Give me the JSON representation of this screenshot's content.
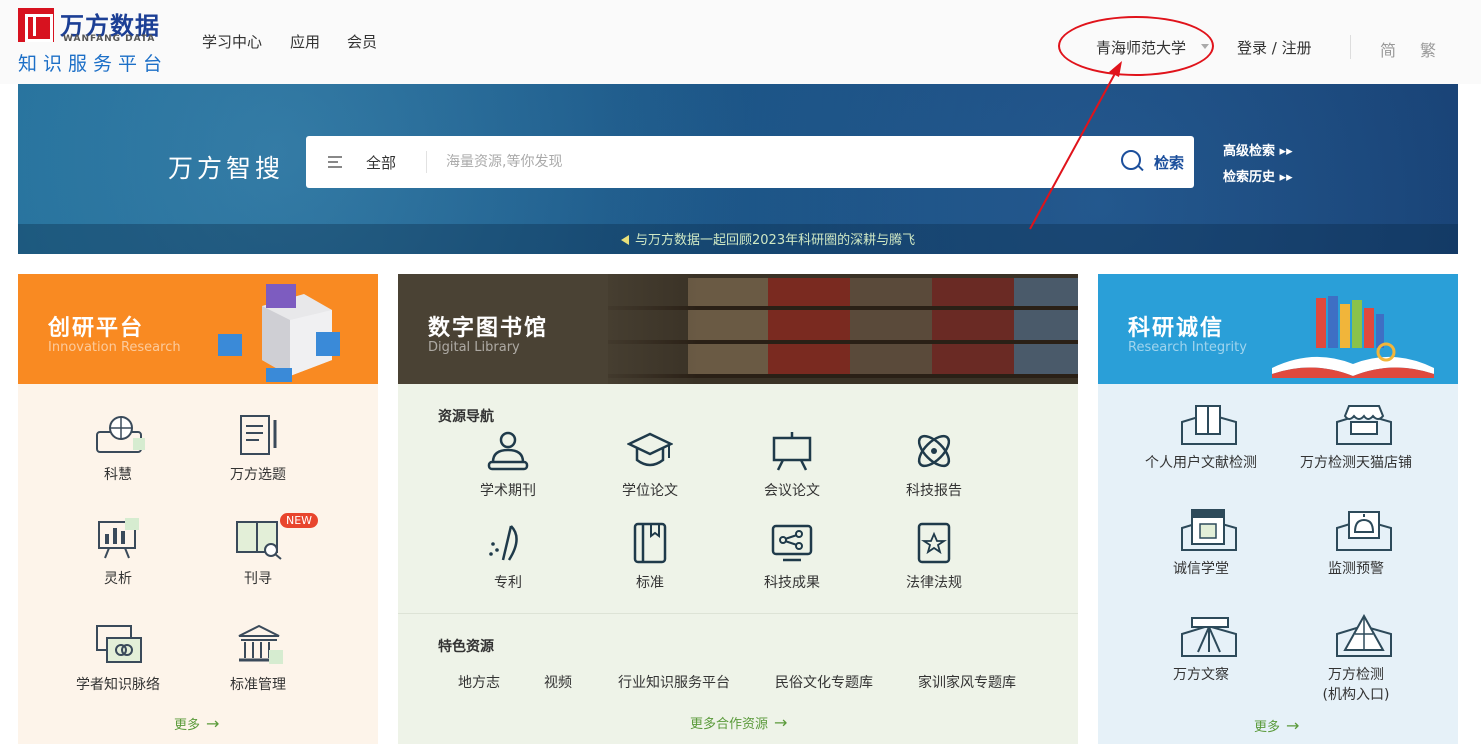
{
  "header": {
    "logo_cn": "万方数据",
    "logo_en": "WANFANG DATA",
    "logo_sub": "知识服务平台",
    "nav": [
      "学习中心",
      "应用",
      "会员"
    ],
    "institution": "青海师范大学",
    "login": "登录 / 注册",
    "lang_simplified": "简",
    "lang_traditional": "繁"
  },
  "search": {
    "title": "万方智搜",
    "category": "全部",
    "placeholder": "海量资源,等你发现",
    "button": "检索",
    "advanced": "高级检索",
    "history": "检索历史",
    "ticker": "与万方数据一起回顾2023年科研圈的深耕与腾飞"
  },
  "innovation": {
    "title": "创研平台",
    "subtitle": "Innovation Research",
    "items": [
      {
        "label": "科慧",
        "icon": "keyboard-globe-icon"
      },
      {
        "label": "万方选题",
        "icon": "document-pen-icon"
      },
      {
        "label": "灵析",
        "icon": "presentation-chart-icon"
      },
      {
        "label": "刊寻",
        "icon": "book-search-icon",
        "badge": "NEW"
      },
      {
        "label": "学者知识脉络",
        "icon": "cards-icon"
      },
      {
        "label": "标准管理",
        "icon": "institution-building-icon"
      }
    ],
    "more": "更多",
    "colors": {
      "header": "#f98a22",
      "body": "#fdf4ea"
    }
  },
  "library": {
    "title": "数字图书馆",
    "subtitle": "Digital Library",
    "nav_title": "资源导航",
    "resources": [
      {
        "label": "学术期刊",
        "icon": "scholar-icon"
      },
      {
        "label": "学位论文",
        "icon": "graduation-cap-icon"
      },
      {
        "label": "会议论文",
        "icon": "easel-icon"
      },
      {
        "label": "科技报告",
        "icon": "orbit-icon"
      },
      {
        "label": "专利",
        "icon": "patent-icon"
      },
      {
        "label": "标准",
        "icon": "book-icon"
      },
      {
        "label": "科技成果",
        "icon": "achievement-icon"
      },
      {
        "label": "法律法规",
        "icon": "law-icon"
      }
    ],
    "special_title": "特色资源",
    "special": [
      "地方志",
      "视频",
      "行业知识服务平台",
      "民俗文化专题库",
      "家训家风专题库"
    ],
    "more": "更多合作资源",
    "colors": {
      "header": "#4a4234",
      "body": "#eef3e8"
    }
  },
  "integrity": {
    "title": "科研诚信",
    "subtitle": "Research Integrity",
    "items": [
      {
        "label": "个人用户文献检测",
        "icon": "open-book-icon"
      },
      {
        "label": "万方检测天猫店铺",
        "icon": "shop-icon"
      },
      {
        "label": "诚信学堂",
        "icon": "school-board-icon"
      },
      {
        "label": "监测预警",
        "icon": "alarm-icon"
      },
      {
        "label": "万方文察",
        "icon": "telescope-icon"
      },
      {
        "label": "万方检测",
        "label2": "(机构入口)",
        "icon": "pyramid-icon"
      }
    ],
    "more": "更多",
    "colors": {
      "header": "#2a9fd8",
      "body": "#e6f1f8"
    }
  }
}
